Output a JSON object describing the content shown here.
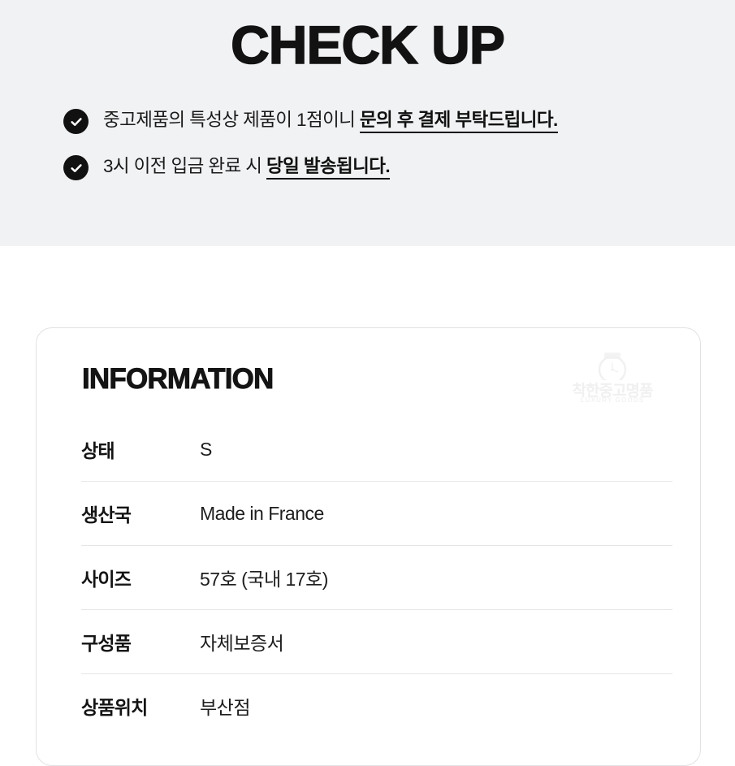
{
  "header": {
    "title": "CHECK UP",
    "background_color": "#f1f2f4",
    "bullets": [
      {
        "icon": "check-circle-icon",
        "text_normal": "중고제품의 특성상 제품이 1점이니 ",
        "text_emphasis": "문의 후 결제 부탁드립니다."
      },
      {
        "icon": "check-circle-icon",
        "text_normal": "3시 이전 입금 완료 시 ",
        "text_emphasis": "당일 발송됩니다."
      }
    ]
  },
  "info_card": {
    "title": "INFORMATION",
    "watermark": {
      "icon": "watch-logo-icon",
      "brand": "착한중고명품",
      "tagline": "LUXURY GOODS"
    },
    "rows": [
      {
        "label": "상태",
        "value": "S"
      },
      {
        "label": "생산국",
        "value": "Made in France"
      },
      {
        "label": "사이즈",
        "value": "57호 (국내 17호)"
      },
      {
        "label": "구성품",
        "value": "자체보증서"
      },
      {
        "label": "상품위치",
        "value": "부산점"
      }
    ]
  },
  "colors": {
    "band_background": "#f1f2f4",
    "page_background": "#ffffff",
    "text_primary": "#141414",
    "icon_fill": "#111111",
    "divider": "#e6e6e8",
    "card_border": "#e2e2e4",
    "watermark": "#f0f0f1"
  }
}
